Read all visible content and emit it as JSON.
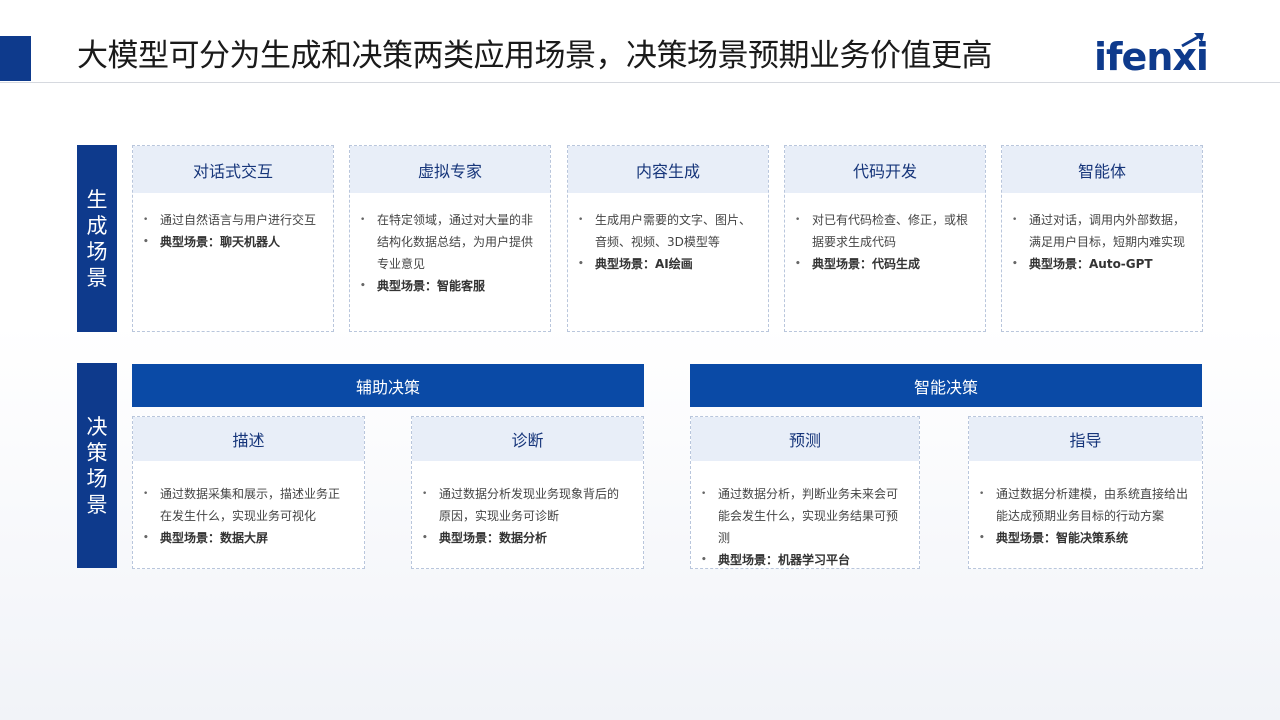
{
  "header": {
    "title": "大模型可分为生成和决策两类应用场景，决策场景预期业务价值更高",
    "logo": "ifenxi"
  },
  "sections": {
    "generation_label": [
      "生",
      "成",
      "场",
      "景"
    ],
    "decision_label": [
      "决",
      "策",
      "场",
      "景"
    ]
  },
  "generation_cards": [
    {
      "title": "对话式交互",
      "bullets": [
        "通过自然语言与用户进行交互"
      ],
      "scene": "典型场景：聊天机器人"
    },
    {
      "title": "虚拟专家",
      "bullets": [
        "在特定领域，通过对大量的非结构化数据总结，为用户提供专业意见"
      ],
      "scene": "典型场景：智能客服"
    },
    {
      "title": "内容生成",
      "bullets": [
        "生成用户需要的文字、图片、音频、视频、3D模型等"
      ],
      "scene": "典型场景：AI绘画"
    },
    {
      "title": "代码开发",
      "bullets": [
        "对已有代码检查、修正，或根据要求生成代码"
      ],
      "scene": "典型场景：代码生成"
    },
    {
      "title": "智能体",
      "bullets": [
        "通过对话，调用内外部数据，满足用户目标，短期内难实现"
      ],
      "scene": "典型场景：Auto-GPT"
    }
  ],
  "decision_bands": [
    "辅助决策",
    "智能决策"
  ],
  "decision_cards": [
    {
      "title": "描述",
      "bullets": [
        "通过数据采集和展示，描述业务正在发生什么，实现业务可视化"
      ],
      "scene": "典型场景：数据大屏"
    },
    {
      "title": "诊断",
      "bullets": [
        "通过数据分析发现业务现象背后的原因，实现业务可诊断"
      ],
      "scene": "典型场景：数据分析"
    },
    {
      "title": "预测",
      "bullets": [
        "通过数据分析，判断业务未来会可能会发生什么，实现业务结果可预测"
      ],
      "scene": "典型场景：机器学习平台"
    },
    {
      "title": "指导",
      "bullets": [
        "通过数据分析建模，由系统直接给出能达成预期业务目标的行动方案"
      ],
      "scene": "典型场景：智能决策系统"
    }
  ],
  "bullet_symbol": "•"
}
